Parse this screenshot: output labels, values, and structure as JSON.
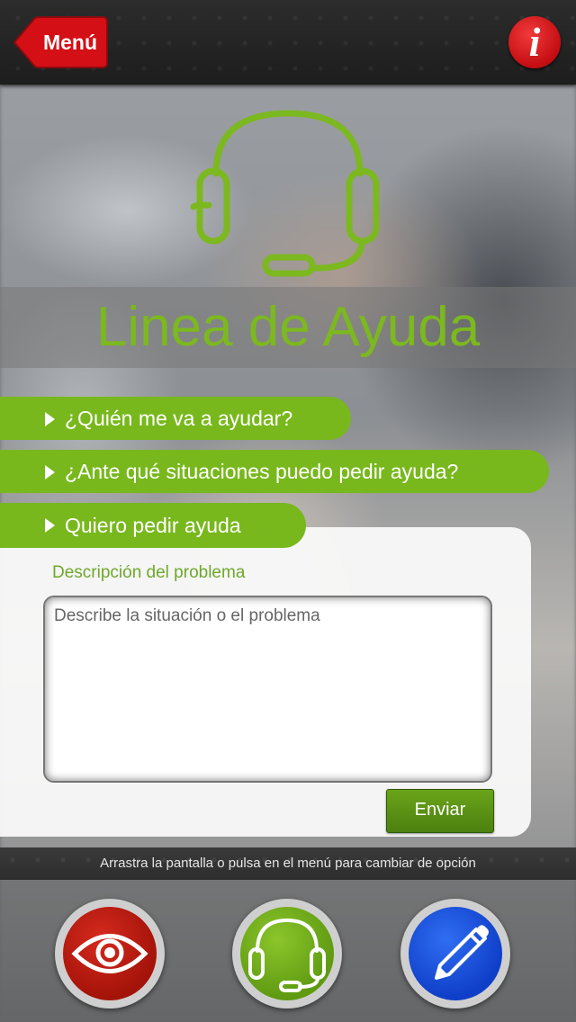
{
  "header": {
    "menu_label": "Menú",
    "info_label": "i"
  },
  "main": {
    "title": "Linea de Ayuda",
    "accordion": [
      {
        "label": "¿Quién me va a ayudar?"
      },
      {
        "label": "¿Ante qué situaciones puedo pedir ayuda?"
      },
      {
        "label": "Quiero pedir ayuda"
      }
    ],
    "form": {
      "description_label": "Descripción del problema",
      "description_placeholder": "Describe la situación o el problema",
      "description_value": "",
      "send_label": "Enviar"
    }
  },
  "hint": "Arrastra la pantalla o pulsa en el menú  para cambiar de opción",
  "bottom_nav": [
    {
      "icon": "eye-icon",
      "color": "#c21a10"
    },
    {
      "icon": "headset-icon",
      "color": "#78b81d"
    },
    {
      "icon": "pencil-icon",
      "color": "#1f55dc"
    }
  ],
  "colors": {
    "accent_green": "#78b81d",
    "danger_red": "#c30d12",
    "nav_blue": "#1f55dc"
  }
}
